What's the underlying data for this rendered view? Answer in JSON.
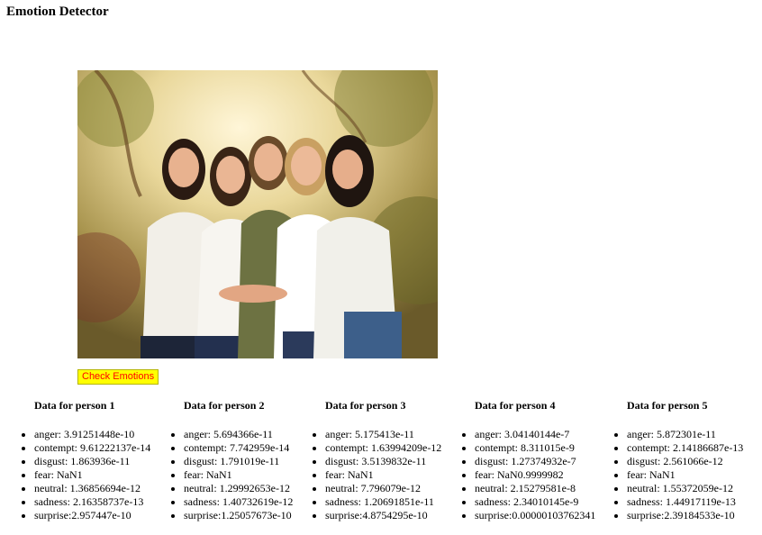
{
  "page": {
    "title": "Emotion Detector",
    "button_label": "Check Emotions"
  },
  "persons": [
    {
      "heading": "Data for person 1",
      "anger": "anger: 3.91251448e-10",
      "contempt": "contempt: 9.61222137e-14",
      "disgust": "disgust: 1.863936e-11",
      "fear": "fear: NaN1",
      "neutral": "neutral: 1.36856694e-12",
      "sadness": "sadness: 2.16358737e-13",
      "surprise": "surprise:2.957447e-10"
    },
    {
      "heading": "Data for person 2",
      "anger": "anger: 5.694366e-11",
      "contempt": "contempt: 7.742959e-14",
      "disgust": "disgust: 1.791019e-11",
      "fear": "fear: NaN1",
      "neutral": "neutral: 1.29992653e-12",
      "sadness": "sadness: 1.40732619e-12",
      "surprise": "surprise:1.25057673e-10"
    },
    {
      "heading": "Data for person 3",
      "anger": "anger: 5.175413e-11",
      "contempt": "contempt: 1.63994209e-12",
      "disgust": "disgust: 3.5139832e-11",
      "fear": "fear: NaN1",
      "neutral": "neutral: 7.796079e-12",
      "sadness": "sadness: 1.20691851e-11",
      "surprise": "surprise:4.8754295e-10"
    },
    {
      "heading": "Data for person 4",
      "anger": "anger: 3.04140144e-7",
      "contempt": "contempt: 8.311015e-9",
      "disgust": "disgust: 1.27374932e-7",
      "fear": "fear: NaN0.9999982",
      "neutral": "neutral: 2.15279581e-8",
      "sadness": "sadness: 2.34010145e-9",
      "surprise": "surprise:0.00000103762341"
    },
    {
      "heading": "Data for person 5",
      "anger": "anger: 5.872301e-11",
      "contempt": "contempt: 2.14186687e-13",
      "disgust": "disgust: 2.561066e-12",
      "fear": "fear: NaN1",
      "neutral": "neutral: 1.55372059e-12",
      "sadness": "sadness: 1.44917119e-13",
      "surprise": "surprise:2.39184533e-10"
    }
  ]
}
